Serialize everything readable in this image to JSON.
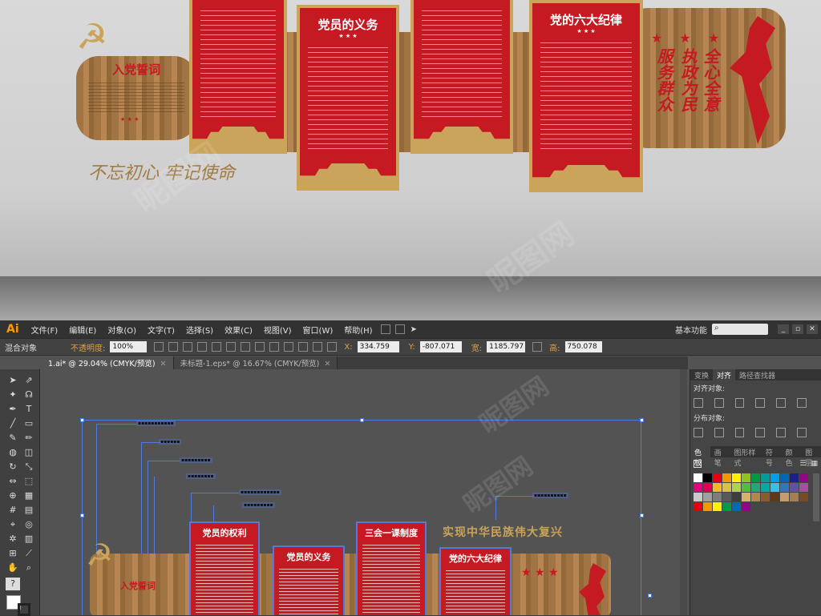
{
  "scene": {
    "oath_title": "入党誓词",
    "obligations_title": "党员的义务",
    "discipline_title": "党的六大纪律",
    "slogan": "不忘初心  牢记使命",
    "vertical_text": [
      "全心全意",
      "执政为民",
      "服务群众"
    ],
    "stars": "★ ★ ★",
    "hammer_glyph": "☭"
  },
  "menubar": {
    "app_logo": "Ai",
    "items": [
      "文件(F)",
      "编辑(E)",
      "对象(O)",
      "文字(T)",
      "选择(S)",
      "效果(C)",
      "视图(V)",
      "窗口(W)",
      "帮助(H)"
    ],
    "workspace": "基本功能",
    "search_placeholder": "",
    "window_buttons": [
      "_",
      "▫",
      "✕"
    ]
  },
  "control_bar": {
    "selection_label": "混合对象",
    "opacity_label": "不透明度:",
    "opacity_value": "100%",
    "x_label": "X:",
    "x_value": "334.759",
    "y_label": "Y:",
    "y_value": "-807.071",
    "w_label": "宽:",
    "w_value": "1185.797",
    "h_label": "高:",
    "h_value": "750.078"
  },
  "doc_tabs": [
    {
      "label": "1.ai* @ 29.04% (CMYK/预览)",
      "active": true
    },
    {
      "label": "未标题-1.eps* @ 16.67% (CMYK/预览)",
      "active": false
    }
  ],
  "canvas": {
    "rights_title": "党员的权利",
    "obligations_title": "党员的义务",
    "meeting_title": "三会一课制度",
    "discipline_title": "党的六大纪律",
    "oath_title": "入党誓词",
    "heading": "实现中华民族伟大复兴"
  },
  "right_panel": {
    "tabs1": [
      "变换",
      "对齐",
      "路径查找器"
    ],
    "align_label": "对齐对象:",
    "distribute_label": "分布对象:",
    "tabs2": [
      "色板",
      "画笔",
      "图形样式",
      "符号",
      "颜色",
      "图层"
    ]
  },
  "swatch_colors": [
    "#ffffff",
    "#000000",
    "#e60012",
    "#f39800",
    "#fff100",
    "#8fc31f",
    "#009944",
    "#009e96",
    "#00a0e9",
    "#0068b7",
    "#1d2088",
    "#920783",
    "#e4007f",
    "#e5004f",
    "#f8b62d",
    "#d7c447",
    "#b0d156",
    "#55b946",
    "#24a67d",
    "#00aaa6",
    "#40bce5",
    "#3974b8",
    "#5f52a0",
    "#a0539d",
    "#c8c8c8",
    "#a0a0a0",
    "#7d7d7d",
    "#595959",
    "#3e3e3e",
    "#d6b26d",
    "#b3864f",
    "#8c5a2f",
    "#603813",
    "#c69c6d",
    "#a67c52",
    "#754c24",
    "#e60012",
    "#f39800",
    "#fff100",
    "#009944",
    "#0068b7",
    "#920783"
  ]
}
